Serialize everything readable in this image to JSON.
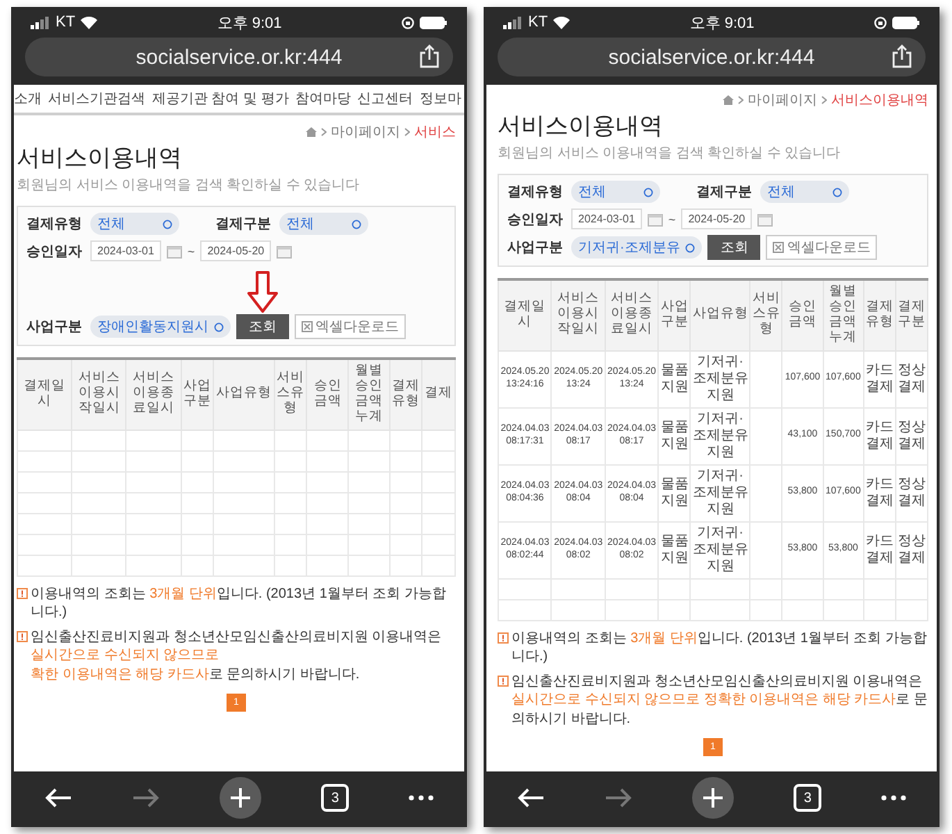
{
  "phones": [
    {
      "status_bar": {
        "carrier": "KT",
        "time": "오후 9:01"
      },
      "address_bar": {
        "url": "socialservice.or.kr:444"
      },
      "nav": [
        "소개",
        "서비스기관검색",
        "제공기관 참여 및 평가",
        "참여마당",
        "신고센터",
        "정보마"
      ],
      "breadcrumb": [
        "마이페이지",
        "서비스"
      ],
      "title": "서비스이용내역",
      "subtitle": "회원님의 서비스 이용내역을 검색 확인하실 수 있습니다",
      "filters": {
        "payment_type": {
          "label": "결제유형",
          "value": "전체"
        },
        "payment_class": {
          "label": "결제구분",
          "value": "전체"
        },
        "approval_date": {
          "label": "승인일자",
          "from": "2024-03-01",
          "separator": "~",
          "to": "2024-05-20"
        },
        "business_class": {
          "label": "사업구분",
          "value": "장애인활동지원시"
        },
        "search_button": "조회",
        "excel_button": "엑셀다운로드"
      },
      "annotation": {
        "kind": "arrow"
      },
      "table": {
        "columns": [
          {
            "label": "결제일시",
            "kind": "date"
          },
          {
            "label": "서비스이용시작일시",
            "kind": "date"
          },
          {
            "label": "서비스이용종료일시",
            "kind": "date"
          },
          {
            "label": "사업구분",
            "kind": "text"
          },
          {
            "label": "사업유형",
            "kind": "wide_text"
          },
          {
            "label": "서비스유형",
            "kind": "text"
          },
          {
            "label": "승인금액",
            "kind": "amount"
          },
          {
            "label": "월별승인금액누계",
            "kind": "amount"
          },
          {
            "label": "결제유형",
            "kind": "text"
          },
          {
            "label": "결제",
            "kind": "text"
          }
        ]
      },
      "notes": [
        [
          "이용내역의 조회는 **3개월 단위**입니다.  (2013년 1월부터 조회 가능합니다.)"
        ],
        [
          "임신출산진료비지원과 청소년산모임신출산의료비지원 이용내역은 **실시간으로 수신되지 않으므로**",
          "**확한 이용내역은 해당 카드사**로 문의하시기 바랍니다."
        ]
      ],
      "pagination": [
        {
          "label": "1",
          "selected": true
        }
      ],
      "toolbar": {
        "back_disabled": false,
        "forward_disabled": true,
        "tab_count": "3"
      }
    },
    {
      "status_bar": {
        "carrier": "KT",
        "time": "오후 9:01"
      },
      "address_bar": {
        "url": "socialservice.or.kr:444"
      },
      "breadcrumb": [
        "마이페이지",
        "서비스이용내역"
      ],
      "title": "서비스이용내역",
      "subtitle": "회원님의 서비스 이용내역을 검색 확인하실 수 있습니다",
      "filters": {
        "payment_type": {
          "label": "결제유형",
          "value": "전체"
        },
        "payment_class": {
          "label": "결제구분",
          "value": "전체"
        },
        "approval_date": {
          "label": "승인일자",
          "from": "2024-03-01",
          "separator": "~",
          "to": "2024-05-20"
        },
        "business_class": {
          "label": "사업구분",
          "value": "기저귀·조제분유"
        },
        "search_button": "조회",
        "excel_button": "엑셀다운로드"
      },
      "table": {
        "columns": [
          {
            "label": "결제일시",
            "kind": "date"
          },
          {
            "label": "서비스이용시작일시",
            "kind": "date"
          },
          {
            "label": "서비스이용종료일시",
            "kind": "date"
          },
          {
            "label": "사업구분",
            "kind": "text"
          },
          {
            "label": "사업유형",
            "kind": "wide_text"
          },
          {
            "label": "서비스유형",
            "kind": "text"
          },
          {
            "label": "승인금액",
            "kind": "amount"
          },
          {
            "label": "월별승인금액누계",
            "kind": "amount"
          },
          {
            "label": "결제유형",
            "kind": "text"
          },
          {
            "label": "결제구분",
            "kind": "text"
          }
        ],
        "rows": [
          [
            "2024.05.20 13:24:16",
            "2024.05.2013:24",
            "2024.05.2013:24",
            "물품지원",
            "기저귀·조제분유지원",
            "",
            "107,600",
            "107,600",
            "카드결제",
            "정상결제"
          ],
          [
            "2024.04.03 08:17:31",
            "2024.04.0308:17",
            "2024.04.0308:17",
            "물품지원",
            "기저귀·조제분유지원",
            "",
            "43,100",
            "150,700",
            "카드결제",
            "정상결제"
          ],
          [
            "2024.04.03 08:04:36",
            "2024.04.0308:04",
            "2024.04.0308:04",
            "물품지원",
            "기저귀·조제분유지원",
            "",
            "53,800",
            "107,600",
            "카드결제",
            "정상결제"
          ],
          [
            "2024.04.03 08:02:44",
            "2024.04.0308:02",
            "2024.04.0308:02",
            "물품지원",
            "기저귀·조제분유지원",
            "",
            "53,800",
            "53,800",
            "카드결제",
            "정상결제"
          ]
        ]
      },
      "notes": [
        [
          "이용내역의 조회는 **3개월 단위**입니다.  (2013년 1월부터 조회 가능합니다.)"
        ],
        [
          "임신출산진료비지원과 청소년산모임신출산의료비지원 이용내역은 **실시간으로 수신되지 않으므로 정확한 이용내역은 해당 카드사**로 문의하시기 바랍니다."
        ]
      ],
      "pagination": [
        {
          "label": "1",
          "selected": true
        }
      ],
      "toolbar": {
        "back_disabled": false,
        "forward_disabled": true,
        "tab_count": "3"
      }
    }
  ]
}
